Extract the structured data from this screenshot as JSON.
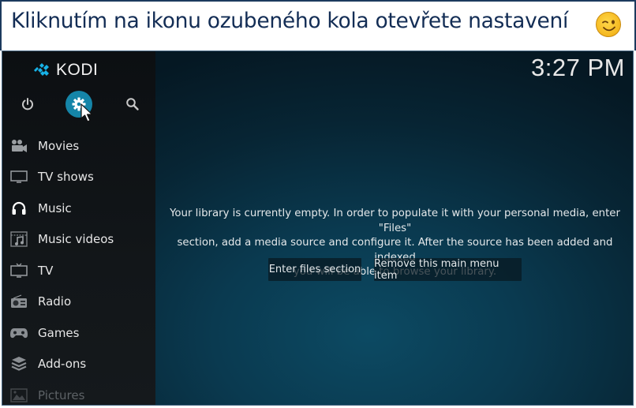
{
  "caption": {
    "text": "Kliknutím na ikonu ozubeného kola otevřete nastavení",
    "emoji": "winking-face-emoji"
  },
  "app": {
    "name": "KODI",
    "clock": "3:27 PM"
  },
  "top_controls": {
    "power_icon": "power-icon",
    "settings_icon": "gear-icon",
    "search_icon": "search-icon",
    "active": "settings"
  },
  "sidebar": {
    "items": [
      {
        "label": "Movies",
        "icon": "movie-camera-icon"
      },
      {
        "label": "TV shows",
        "icon": "tv-monitor-icon"
      },
      {
        "label": "Music",
        "icon": "headphones-icon"
      },
      {
        "label": "Music videos",
        "icon": "music-video-icon"
      },
      {
        "label": "TV",
        "icon": "tv-antenna-icon"
      },
      {
        "label": "Radio",
        "icon": "radio-icon"
      },
      {
        "label": "Games",
        "icon": "gamepad-icon"
      },
      {
        "label": "Add-ons",
        "icon": "addons-box-icon"
      },
      {
        "label": "Pictures",
        "icon": "picture-icon"
      }
    ]
  },
  "main": {
    "message_lines": [
      "Your library is currently empty. In order to populate it with your personal media, enter \"Files\"",
      "section, add a media source and configure it. After the source has been added and indexed",
      "you will be able to browse your library."
    ],
    "buttons": {
      "enter_files": "Enter files section",
      "remove_item": "Remove this main menu item"
    }
  },
  "colors": {
    "accent": "#1585a8",
    "caption_text": "#132d55",
    "logo_blue": "#17b2e7"
  }
}
